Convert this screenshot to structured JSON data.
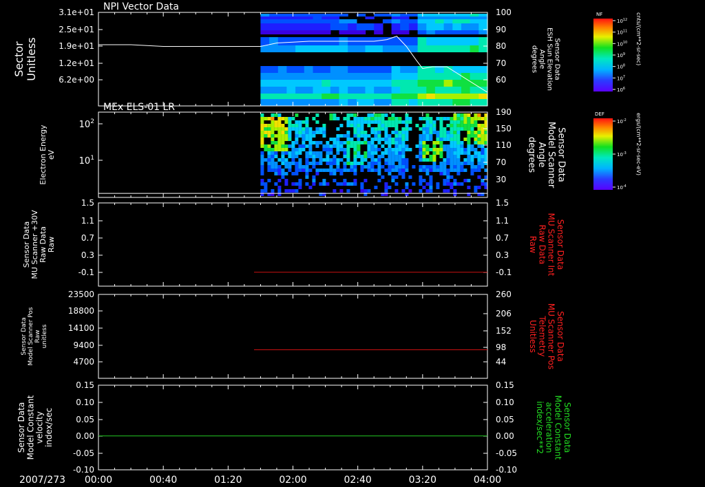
{
  "colors": {
    "background": "#000000",
    "frame": "#ffffff",
    "trace_white": "#ffffff",
    "trace_red": "#cc1111",
    "trace_green": "#22cc22",
    "label_red": "#ff2020",
    "label_green": "#22dd22"
  },
  "time_axis": {
    "date_label": "2007/273",
    "ticks": [
      "00:00",
      "00:40",
      "01:20",
      "02:00",
      "02:40",
      "03:20",
      "04:00"
    ],
    "range_min": [
      0,
      240
    ]
  },
  "colorbars": [
    {
      "name": "NF",
      "unit_label": "cnts/(cm**2-sr-sec)",
      "tick_labels": [
        "10^12",
        "10^11",
        "10^10",
        "10^9",
        "10^8",
        "10^7",
        "10^6"
      ]
    },
    {
      "name": "DEF",
      "unit_label": "ergs/(cm**2-sr-sec-eV)",
      "tick_labels": [
        "10^-2",
        "10^-3",
        "10^-4"
      ]
    }
  ],
  "chart_data": [
    {
      "type": "heatmap",
      "title": "NPI Vector Data",
      "left_axis": {
        "label_lines": [
          "Sector",
          "Unitless"
        ],
        "ticks": [
          "3.1e+01",
          "2.5e+01",
          "1.9e+01",
          "1.2e+01",
          "6.2e+00"
        ],
        "range": [
          0,
          32
        ]
      },
      "right_axis": {
        "label_lines": [
          "Sensor Data",
          "ESH Sun Elevation",
          "Angle",
          "degrees"
        ],
        "ticks": [
          "100",
          "90",
          "80",
          "70",
          "60"
        ],
        "range": [
          45,
          100
        ]
      },
      "data_start_min": 100,
      "overlay_line": {
        "x": [
          0,
          20,
          40,
          60,
          80,
          90,
          100,
          110,
          130,
          150,
          170,
          178,
          184,
          190,
          196,
          200,
          206,
          215,
          225,
          240
        ],
        "y": [
          81,
          81,
          80,
          80,
          80,
          80,
          80,
          82,
          83,
          83,
          83,
          84,
          86,
          80,
          72,
          67,
          68,
          68,
          62,
          53
        ]
      }
    },
    {
      "type": "heatmap",
      "title": "MEx ELS-01 LR",
      "left_axis": {
        "label_lines": [
          "Electron Energy",
          "eV"
        ],
        "ticks": [
          "10^2",
          "10^1"
        ],
        "scale": "log",
        "range": [
          1.2,
          180
        ]
      },
      "right_axis": {
        "label_lines": [
          "Sensor Data",
          "Model Scanner",
          "Angle",
          "degrees"
        ],
        "ticks": [
          "190",
          "150",
          "110",
          "70",
          "30"
        ],
        "range": [
          0,
          190
        ]
      },
      "data_start_min": 100,
      "overlay_line": {
        "x": [
          0,
          240
        ],
        "y": [
          9,
          9
        ]
      }
    },
    {
      "type": "line",
      "left_axis": {
        "label_lines": [
          "Sensor Data",
          "MU Scanner +30V",
          "Raw Data",
          "Raw"
        ],
        "ticks": [
          "1.5",
          "1.1",
          "0.7",
          "0.3",
          "-0.1"
        ],
        "range": [
          -0.3,
          1.5
        ]
      },
      "right_axis": {
        "label_lines": [
          "Sensor Data",
          "MU Scanner Int",
          "Raw Data",
          "Raw"
        ],
        "ticks": [
          "1.5",
          "1.1",
          "0.7",
          "0.3",
          "-0.1"
        ],
        "range": [
          -0.3,
          1.5
        ]
      },
      "series": [
        {
          "x": [
            96,
            240
          ],
          "y": [
            0.0,
            0.0
          ]
        }
      ]
    },
    {
      "type": "line",
      "left_axis": {
        "label_lines": [
          "Sensor Data",
          "Model Scanner Pos",
          "Raw",
          "unitless"
        ],
        "ticks": [
          "23500",
          "18800",
          "14100",
          "9400",
          "4700"
        ],
        "range": [
          0,
          23500
        ]
      },
      "right_axis": {
        "label_lines": [
          "Sensor Data",
          "MU Scanner Pos",
          "Telemetry",
          "Unitless"
        ],
        "ticks": [
          "260",
          "206",
          "152",
          "98",
          "44"
        ],
        "range": [
          0,
          260
        ]
      },
      "series": [
        {
          "x": [
            96,
            240
          ],
          "y": [
            8000,
            8000
          ]
        }
      ]
    },
    {
      "type": "line",
      "left_axis": {
        "label_lines": [
          "Sensor Data",
          "Model Constant",
          "velocity",
          "index/sec"
        ],
        "ticks": [
          "0.15",
          "0.10",
          "0.05",
          "0.00",
          "-0.05",
          "-0.10"
        ],
        "range": [
          -0.1,
          0.15
        ]
      },
      "right_axis": {
        "label_lines": [
          "Sensor Data",
          "Model Constant",
          "acceleration",
          "index/sec**2"
        ],
        "ticks": [
          "0.15",
          "0.10",
          "0.05",
          "0.00",
          "-0.05",
          "-0.10"
        ],
        "range": [
          -0.1,
          0.15
        ]
      },
      "series": [
        {
          "x": [
            0,
            240
          ],
          "y": [
            0.0,
            0.0
          ]
        }
      ]
    }
  ]
}
